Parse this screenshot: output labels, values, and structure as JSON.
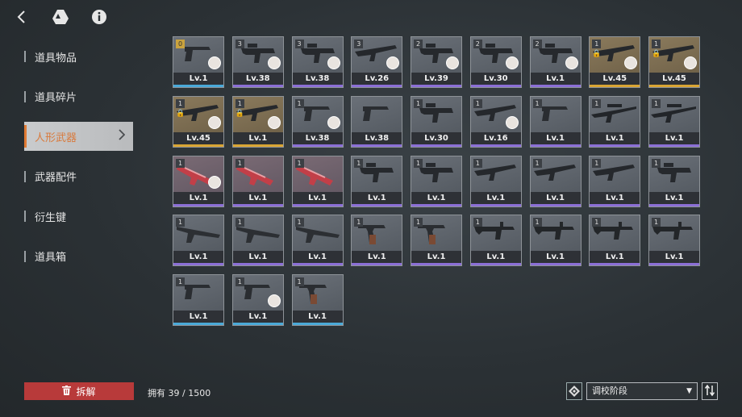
{
  "sidebar": {
    "items": [
      {
        "label": "道具物品"
      },
      {
        "label": "道具碎片"
      },
      {
        "label": "人形武器"
      },
      {
        "label": "武器配件"
      },
      {
        "label": "衍生键"
      },
      {
        "label": "道具箱"
      }
    ],
    "active_index": 2
  },
  "footer": {
    "dismantle_label": "拆解",
    "count_label": "拥有 39 / 1500",
    "sort_select_value": "调校阶段"
  },
  "colors": {
    "rarity_blue": "#4aa9d8",
    "rarity_purple": "#8b6fd6",
    "rarity_gold": "#d9a534",
    "dismantle": "#b83a3a",
    "active_nav": "#e07a33"
  },
  "weapons": [
    {
      "level": "Lv.1",
      "badge": "0",
      "rarity": "blue",
      "shape": "pistol",
      "avatar": true
    },
    {
      "level": "Lv.38",
      "badge": "3",
      "rarity": "purple",
      "shape": "smg",
      "avatar": true
    },
    {
      "level": "Lv.38",
      "badge": "3",
      "rarity": "purple",
      "shape": "smg",
      "avatar": true
    },
    {
      "level": "Lv.26",
      "badge": "3",
      "rarity": "purple",
      "shape": "rifle",
      "avatar": true
    },
    {
      "level": "Lv.39",
      "badge": "2",
      "rarity": "purple",
      "shape": "smg",
      "avatar": true
    },
    {
      "level": "Lv.30",
      "badge": "2",
      "rarity": "purple",
      "shape": "smg",
      "avatar": true
    },
    {
      "level": "Lv.1",
      "badge": "2",
      "rarity": "purple",
      "shape": "smg",
      "avatar": true
    },
    {
      "level": "Lv.45",
      "badge": "1",
      "rarity": "gold",
      "shape": "rifle",
      "avatar": true,
      "lock": true
    },
    {
      "level": "Lv.45",
      "badge": "1",
      "rarity": "gold",
      "shape": "rifle",
      "avatar": true,
      "lock": true
    },
    {
      "level": "Lv.45",
      "badge": "1",
      "rarity": "gold",
      "shape": "rifle",
      "avatar": true,
      "lock": true
    },
    {
      "level": "Lv.1",
      "badge": "1",
      "rarity": "gold",
      "shape": "rifle",
      "avatar": true,
      "lock": true
    },
    {
      "level": "Lv.38",
      "badge": "1",
      "rarity": "purple",
      "shape": "pistol",
      "avatar": true
    },
    {
      "level": "Lv.38",
      "badge": "",
      "rarity": "purple",
      "shape": "pistol",
      "avatar": false
    },
    {
      "level": "Lv.30",
      "badge": "1",
      "rarity": "purple",
      "shape": "smg",
      "avatar": false
    },
    {
      "level": "Lv.16",
      "badge": "1",
      "rarity": "purple",
      "shape": "rifle",
      "avatar": true
    },
    {
      "level": "Lv.1",
      "badge": "1",
      "rarity": "purple",
      "shape": "pistol",
      "avatar": false
    },
    {
      "level": "Lv.1",
      "badge": "1",
      "rarity": "purple",
      "shape": "sniper",
      "avatar": false
    },
    {
      "level": "Lv.1",
      "badge": "1",
      "rarity": "purple",
      "shape": "sniper",
      "avatar": false
    },
    {
      "level": "Lv.1",
      "badge": "1",
      "rarity": "purple",
      "shape": "red",
      "avatar": true
    },
    {
      "level": "Lv.1",
      "badge": "1",
      "rarity": "purple",
      "shape": "red",
      "avatar": false
    },
    {
      "level": "Lv.1",
      "badge": "1",
      "rarity": "purple",
      "shape": "red",
      "avatar": false
    },
    {
      "level": "Lv.1",
      "badge": "1",
      "rarity": "purple",
      "shape": "smg",
      "avatar": false
    },
    {
      "level": "Lv.1",
      "badge": "1",
      "rarity": "purple",
      "shape": "smg",
      "avatar": false
    },
    {
      "level": "Lv.1",
      "badge": "1",
      "rarity": "purple",
      "shape": "rifle",
      "avatar": false
    },
    {
      "level": "Lv.1",
      "badge": "1",
      "rarity": "purple",
      "shape": "rifle",
      "avatar": false
    },
    {
      "level": "Lv.1",
      "badge": "1",
      "rarity": "purple",
      "shape": "rifle",
      "avatar": false
    },
    {
      "level": "Lv.1",
      "badge": "1",
      "rarity": "purple",
      "shape": "smg",
      "avatar": false
    },
    {
      "level": "Lv.1",
      "badge": "1",
      "rarity": "purple",
      "shape": "shotgun",
      "avatar": false
    },
    {
      "level": "Lv.1",
      "badge": "1",
      "rarity": "purple",
      "shape": "shotgun",
      "avatar": false
    },
    {
      "level": "Lv.1",
      "badge": "1",
      "rarity": "purple",
      "shape": "shotgun",
      "avatar": false
    },
    {
      "level": "Lv.1",
      "badge": "1",
      "rarity": "purple",
      "shape": "revolver",
      "avatar": false
    },
    {
      "level": "Lv.1",
      "badge": "1",
      "rarity": "purple",
      "shape": "revolver",
      "avatar": false
    },
    {
      "level": "Lv.1",
      "badge": "1",
      "rarity": "purple",
      "shape": "mg",
      "avatar": false
    },
    {
      "level": "Lv.1",
      "badge": "1",
      "rarity": "purple",
      "shape": "mg",
      "avatar": false
    },
    {
      "level": "Lv.1",
      "badge": "1",
      "rarity": "purple",
      "shape": "mg",
      "avatar": false
    },
    {
      "level": "Lv.1",
      "badge": "1",
      "rarity": "purple",
      "shape": "mg",
      "avatar": false
    },
    {
      "level": "Lv.1",
      "badge": "1",
      "rarity": "blue",
      "shape": "pistol",
      "avatar": false
    },
    {
      "level": "Lv.1",
      "badge": "1",
      "rarity": "blue",
      "shape": "pistol",
      "avatar": true
    },
    {
      "level": "Lv.1",
      "badge": "1",
      "rarity": "blue",
      "shape": "revolver",
      "avatar": false
    }
  ]
}
